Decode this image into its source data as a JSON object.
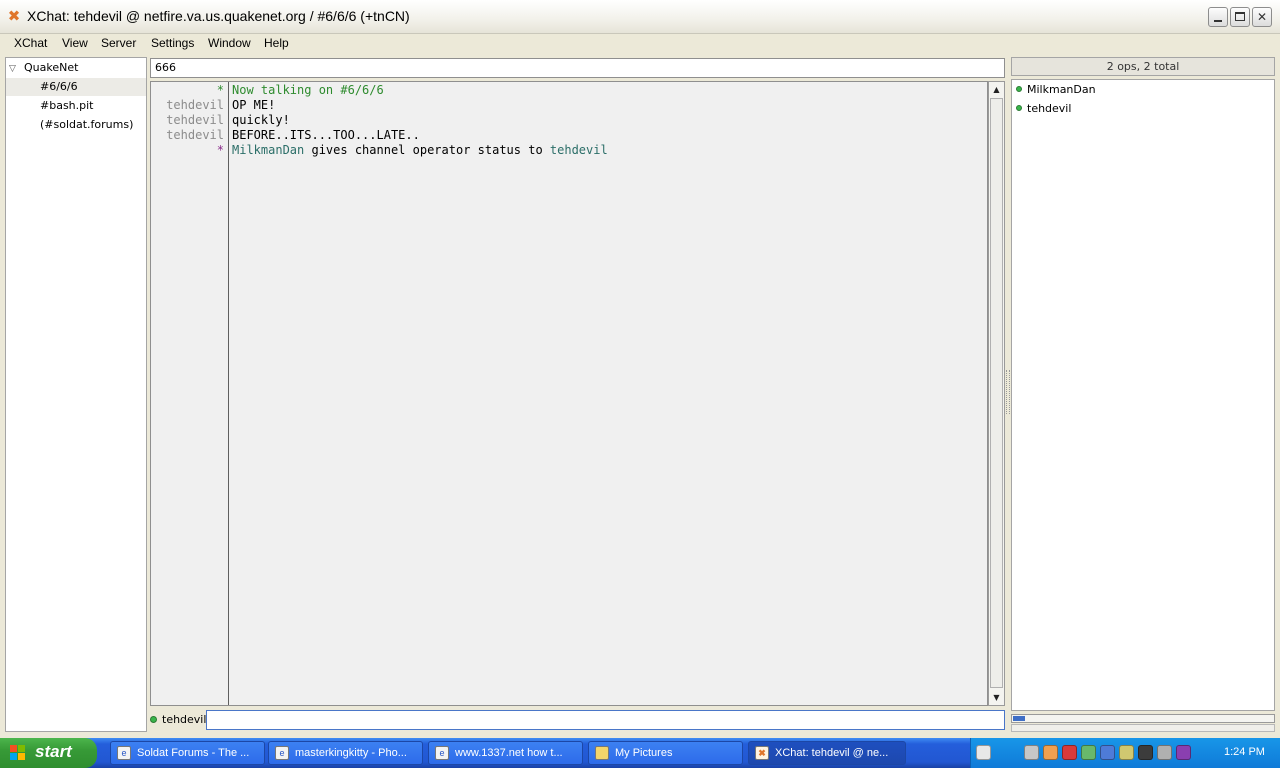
{
  "window": {
    "title": "XChat: tehdevil @ netfire.va.us.quakenet.org / #6/6/6 (+tnCN)"
  },
  "menu": [
    "XChat",
    "View",
    "Server",
    "Settings",
    "Window",
    "Help"
  ],
  "tree": {
    "network": "QuakeNet",
    "channels": [
      "#6/6/6",
      "#bash.pit",
      "(#soldat.forums)"
    ]
  },
  "topic": "666",
  "chat": {
    "lines": [
      {
        "nick": "*",
        "parts": [
          {
            "text": "Now talking on #6/6/6"
          }
        ]
      },
      {
        "nick": "tehdevil",
        "parts": [
          {
            "text": "OP ME!"
          }
        ]
      },
      {
        "nick": "tehdevil",
        "parts": [
          {
            "text": "quickly!"
          }
        ]
      },
      {
        "nick": "tehdevil",
        "parts": [
          {
            "text": "BEFORE..ITS...TOO...LATE.."
          }
        ]
      },
      {
        "nick": "*",
        "parts": [
          {
            "text": "MilkmanDan"
          },
          {
            "text": " gives channel operator status to "
          },
          {
            "text": "tehdevil"
          }
        ]
      }
    ]
  },
  "userlist": {
    "header": "2 ops, 2 total",
    "users": [
      "MilkmanDan",
      "tehdevil"
    ]
  },
  "input": {
    "nick": "tehdevil",
    "value": ""
  },
  "taskbar": {
    "start": "start",
    "tasks": [
      {
        "label": "Soldat Forums - The ..."
      },
      {
        "label": "masterkingkitty - Pho..."
      },
      {
        "label": "www.1337.net how t..."
      },
      {
        "label": "My Pictures"
      },
      {
        "label": "XChat: tehdevil @ ne..."
      }
    ],
    "clock": "1:24 PM"
  },
  "colors": {
    "status_green": "#2e8b2e",
    "nick_grey": "#8c8c8c",
    "highlight_teal": "#2b6e68",
    "action_star": "#8a2b8a",
    "taskbar_blue": "#245edb",
    "start_green": "#379a37"
  },
  "icons": {
    "app": "xchat-icon",
    "expander": "triangle-down-icon",
    "op": "op-status-icon"
  }
}
